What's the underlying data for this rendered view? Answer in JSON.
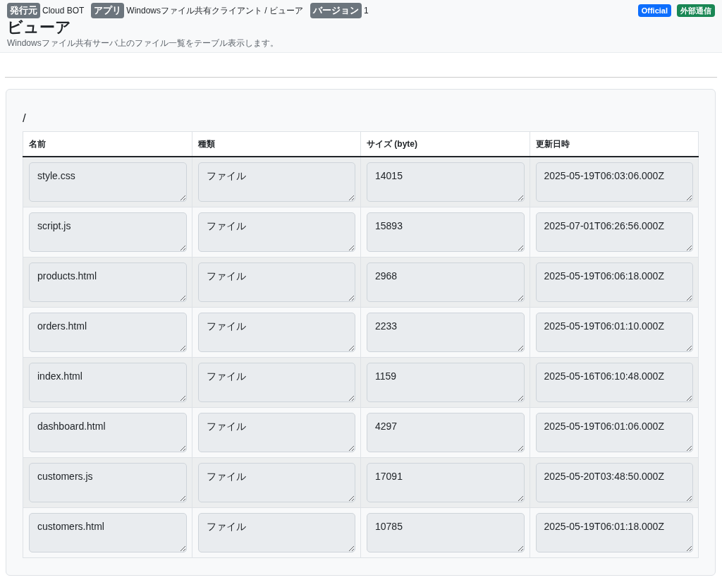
{
  "header": {
    "meta": [
      {
        "label": "発行元",
        "value": "Cloud BOT"
      },
      {
        "label": "アプリ",
        "value": "Windowsファイル共有クライアント / ビューア"
      },
      {
        "label": "バージョン",
        "value": "1"
      }
    ],
    "badges": [
      {
        "text": "Official",
        "color": "#0d6efd"
      },
      {
        "text": "外部通信",
        "color": "#198754"
      }
    ],
    "title": "ビューア",
    "description": "Windowsファイル共有サーバ上のファイル一覧をテーブル表示します。"
  },
  "path": "/",
  "table": {
    "columns": [
      "名前",
      "種類",
      "サイズ (byte)",
      "更新日時"
    ],
    "rows": [
      [
        "style.css",
        "ファイル",
        "14015",
        "2025-05-19T06:03:06.000Z"
      ],
      [
        "script.js",
        "ファイル",
        "15893",
        "2025-07-01T06:26:56.000Z"
      ],
      [
        "products.html",
        "ファイル",
        "2968",
        "2025-05-19T06:06:18.000Z"
      ],
      [
        "orders.html",
        "ファイル",
        "2233",
        "2025-05-19T06:01:10.000Z"
      ],
      [
        "index.html",
        "ファイル",
        "1159",
        "2025-05-16T06:10:48.000Z"
      ],
      [
        "dashboard.html",
        "ファイル",
        "4297",
        "2025-05-19T06:01:06.000Z"
      ],
      [
        "customers.js",
        "ファイル",
        "17091",
        "2025-05-20T03:48:50.000Z"
      ],
      [
        "customers.html",
        "ファイル",
        "10785",
        "2025-05-19T06:01:18.000Z"
      ]
    ]
  }
}
